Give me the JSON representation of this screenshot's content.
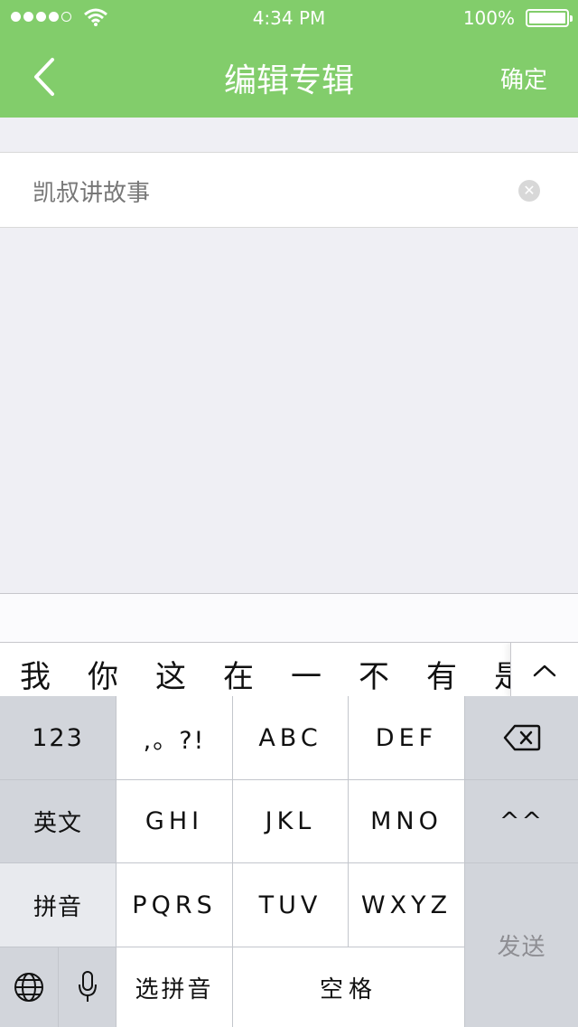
{
  "status_bar": {
    "time": "4:34 PM",
    "battery": "100%",
    "signal_icon": "signal-dots-icon",
    "wifi_icon": "wifi-icon",
    "battery_icon": "battery-icon"
  },
  "nav": {
    "title": "编辑专辑",
    "confirm_label": "确定",
    "back_icon": "chevron-left-icon",
    "color": "#82cd6b"
  },
  "album_name_input": {
    "value": "凯叔讲故事",
    "clear_icon": "clear-circle-icon"
  },
  "keyboard": {
    "candidates": [
      "我",
      "你",
      "这",
      "在",
      "一",
      "不",
      "有",
      "是"
    ],
    "expand_icon": "chevron-up-icon",
    "keys": {
      "num": "123",
      "punct": ",。?!",
      "abc": "ABC",
      "def": "DEF",
      "backspace_icon": "backspace-icon",
      "en": "英文",
      "ghi": "GHI",
      "jkl": "JKL",
      "mno": "MNO",
      "emoticon": "^^",
      "pinyin": "拼音",
      "pqrs": "PQRS",
      "tuv": "TUV",
      "wxyz": "WXYZ",
      "send": "发送",
      "globe_icon": "globe-icon",
      "mic_icon": "microphone-icon",
      "select_pinyin": "选拼音",
      "space": "空格"
    }
  }
}
